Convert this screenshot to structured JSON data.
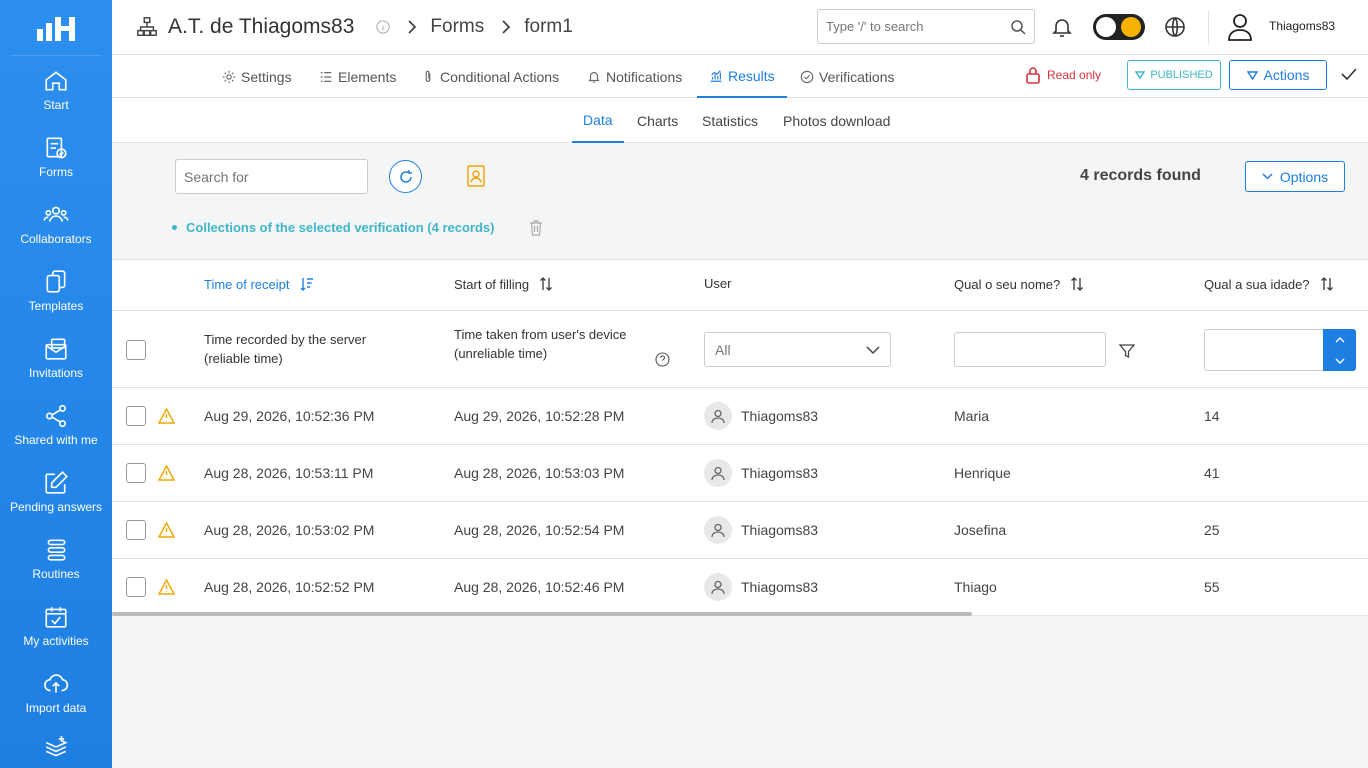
{
  "sidebar": {
    "items": [
      {
        "label": "Start",
        "icon": "home-icon"
      },
      {
        "label": "Forms",
        "icon": "forms-icon"
      },
      {
        "label": "Collaborators",
        "icon": "collaborators-icon"
      },
      {
        "label": "Templates",
        "icon": "templates-icon"
      },
      {
        "label": "Invitations",
        "icon": "invitations-icon"
      },
      {
        "label": "Shared with me",
        "icon": "share-icon"
      },
      {
        "label": "Pending answers",
        "icon": "edit-icon"
      },
      {
        "label": "Routines",
        "icon": "routines-icon"
      },
      {
        "label": "My activities",
        "icon": "calendar-check-icon"
      },
      {
        "label": "Import data",
        "icon": "cloud-upload-icon"
      }
    ]
  },
  "header": {
    "org_title": "A.T. de Thiagoms83",
    "crumb_forms": "Forms",
    "crumb_form": "form1",
    "search_placeholder": "Type '/' to search",
    "username": "Thiagoms83"
  },
  "nav": {
    "tabs": [
      {
        "label": "Settings"
      },
      {
        "label": "Elements"
      },
      {
        "label": "Conditional Actions"
      },
      {
        "label": "Notifications"
      },
      {
        "label": "Results"
      },
      {
        "label": "Verifications"
      }
    ],
    "read_only": "Read only",
    "published": "PUBLISHED",
    "actions": "Actions"
  },
  "subtabs": [
    "Data",
    "Charts",
    "Statistics",
    "Photos download"
  ],
  "filters": {
    "search_placeholder": "Search for",
    "records_found": "4 records found",
    "options": "Options",
    "collection": "Collections of the selected verification (4 records)"
  },
  "table": {
    "headers": [
      "Time of receipt",
      "Start of filling",
      "User",
      "Qual o seu nome?",
      "Qual a sua idade?"
    ],
    "receipt_note": "Time recorded by the server (reliable time)",
    "filling_note": "Time taken from user's device (unreliable time)",
    "user_select": "All",
    "rows": [
      {
        "receipt": "Aug 29, 2026, 10:52:36 PM",
        "filling": "Aug 29, 2026, 10:52:28 PM",
        "user": "Thiagoms83",
        "name": "Maria",
        "age": "14"
      },
      {
        "receipt": "Aug 28, 2026, 10:53:11 PM",
        "filling": "Aug 28, 2026, 10:53:03 PM",
        "user": "Thiagoms83",
        "name": "Henrique",
        "age": "41"
      },
      {
        "receipt": "Aug 28, 2026, 10:53:02 PM",
        "filling": "Aug 28, 2026, 10:52:54 PM",
        "user": "Thiagoms83",
        "name": "Josefina",
        "age": "25"
      },
      {
        "receipt": "Aug 28, 2026, 10:52:52 PM",
        "filling": "Aug 28, 2026, 10:52:46 PM",
        "user": "Thiagoms83",
        "name": "Thiago",
        "age": "55"
      }
    ]
  },
  "colors": {
    "primary": "#1e7fe2",
    "teal": "#3fb6c8",
    "danger": "#d6333b",
    "warning": "#f0a500"
  }
}
